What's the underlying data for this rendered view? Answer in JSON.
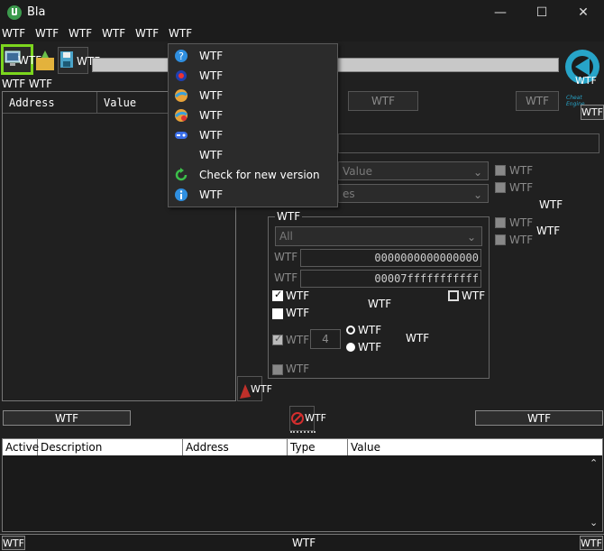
{
  "window": {
    "title": "Bla",
    "minimize": "—",
    "maximize": "☐",
    "close": "✕"
  },
  "menu": [
    "WTF",
    "WTF",
    "WTF",
    "WTF",
    "WTF",
    "WTF"
  ],
  "toolbar": {
    "open_label": "WTF",
    "caption_left": "WTF WTF",
    "logo_text": "WTF",
    "logo_sub": "Cheat Engine",
    "settings_label": "WTF"
  },
  "dropdown": [
    {
      "icon": "help-icon",
      "label": "WTF"
    },
    {
      "icon": "tutorial-icon",
      "label": "WTF"
    },
    {
      "icon": "planet-icon",
      "label": "WTF"
    },
    {
      "icon": "planet-alt-icon",
      "label": "WTF"
    },
    {
      "icon": "gamepad-icon",
      "label": "WTF"
    },
    {
      "icon": "",
      "label": "WTF"
    },
    {
      "icon": "refresh-icon",
      "label": "Check for new version"
    },
    {
      "icon": "info-icon",
      "label": "WTF"
    }
  ],
  "addr_list": {
    "col_address": "Address",
    "col_value": "Value"
  },
  "scan": {
    "first_scan": "WTF",
    "undo_scan": "WTF",
    "value_type": "Value",
    "scan_type": "es",
    "opt1": "WTF",
    "opt2": "WTF",
    "opt3": "WTF",
    "opt4": "WTF",
    "right_label1": "WTF",
    "right_label2": "WTF",
    "group_title": "WTF",
    "region": "All",
    "start_label": "WTF",
    "start_value": "0000000000000000",
    "stop_label": "WTF",
    "stop_value": "00007fffffffffff",
    "writable": "WTF",
    "executable": "WTF",
    "copy_on_write": "WTF",
    "mid_label": "WTF",
    "fast_scan": "WTF",
    "fast_value": "4",
    "align_label": "WTF",
    "last_digits": "WTF",
    "pause_label": "WTF",
    "bottom_check": "WTF"
  },
  "actions": {
    "memory_view": "WTF",
    "clear_label": "WTF",
    "add_address": "WTF"
  },
  "table": {
    "cols": [
      "Active",
      "Description",
      "Address",
      "Type",
      "Value"
    ]
  },
  "status": {
    "left": "WTF",
    "center": "WTF",
    "right": "WTF"
  },
  "colors": {
    "accent": "#3c9a4d",
    "highlight": "#7cd61e",
    "panel": "#202020"
  }
}
